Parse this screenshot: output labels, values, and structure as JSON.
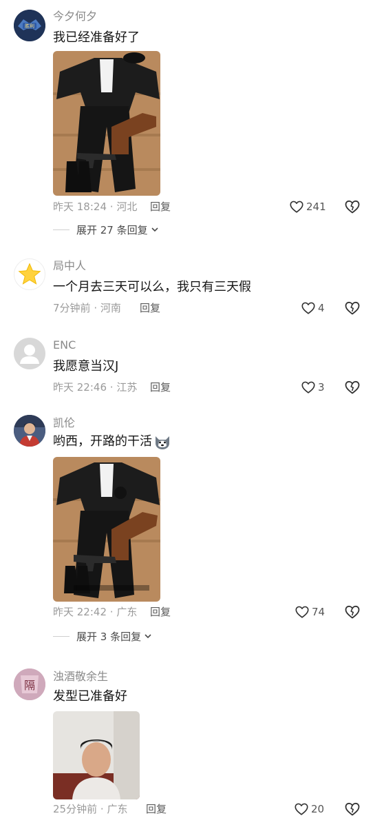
{
  "comments": [
    {
      "name": "今夕何夕",
      "text": "我已经准备好了",
      "time": "昨天 18:24",
      "location": "河北",
      "reply": "回复",
      "likes": "241",
      "expand": "展开 27 条回复",
      "avatar_label": "胜利"
    },
    {
      "name": "局中人",
      "text": "一个月去三天可以么，我只有三天假",
      "time": "7分钟前",
      "location": "河南",
      "reply": "回复",
      "likes": "4"
    },
    {
      "name": "ENC",
      "text": "我愿意当汉J",
      "time": "昨天 22:46",
      "location": "江苏",
      "reply": "回复",
      "likes": "3"
    },
    {
      "name": "凯伦",
      "text": "哟西，开路的干活",
      "time": "昨天 22:42",
      "location": "广东",
      "reply": "回复",
      "likes": "74",
      "expand": "展开 3 条回复"
    },
    {
      "name": "浊酒敬余生",
      "text": "发型已准备好",
      "time": "25分钟前",
      "location": "广东",
      "reply": "回复",
      "likes": "20",
      "avatar_label": "隔"
    }
  ],
  "separator": "·",
  "icons": {
    "like": "heart-outline-icon",
    "dislike": "broken-heart-icon",
    "expand": "chevron-down-icon"
  },
  "colors": {
    "text": "#161616",
    "meta": "#9a9a9a",
    "name": "#8a8a8a"
  }
}
